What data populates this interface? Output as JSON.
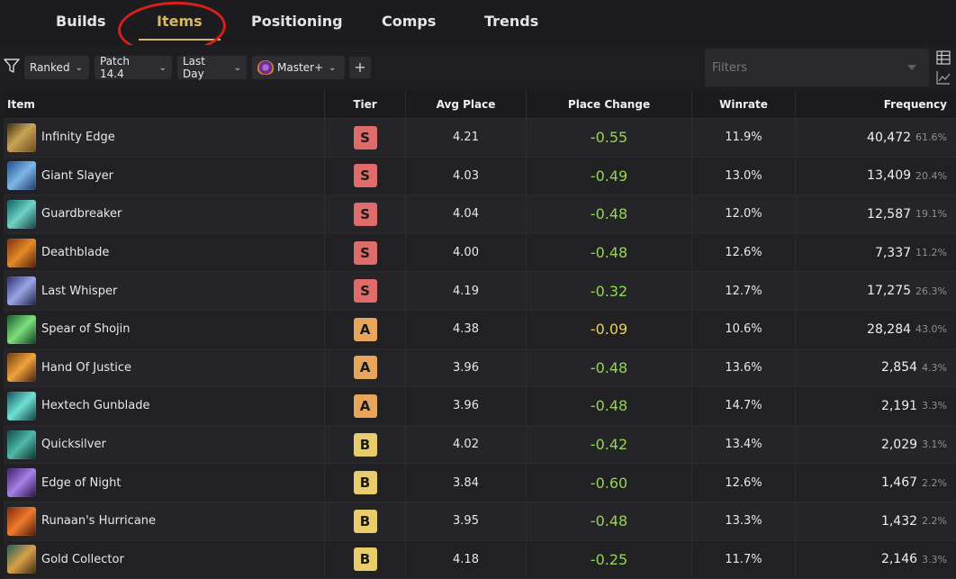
{
  "nav": {
    "tabs": [
      {
        "label": "Builds"
      },
      {
        "label": "Items"
      },
      {
        "label": "Positioning"
      },
      {
        "label": "Comps"
      },
      {
        "label": "Trends"
      }
    ],
    "active_tab": "Items",
    "highlight_color": "#d81e1e"
  },
  "filters": {
    "queue": "Ranked",
    "patch": "Patch 14.4",
    "period": "Last Day",
    "rank": "Master+",
    "add_label": "+",
    "search_placeholder": "Filters"
  },
  "table": {
    "headers": {
      "item": "Item",
      "tier": "Tier",
      "avg_place": "Avg Place",
      "place_change": "Place Change",
      "winrate": "Winrate",
      "frequency": "Frequency"
    },
    "rows": [
      {
        "name": "Infinity Edge",
        "icon": "infinity-edge-icon",
        "tier": "S",
        "avg": "4.21",
        "change": "-0.55",
        "winrate": "11.9%",
        "freq": "40,472",
        "pct": "61.6%"
      },
      {
        "name": "Giant Slayer",
        "icon": "giant-slayer-icon",
        "tier": "S",
        "avg": "4.03",
        "change": "-0.49",
        "winrate": "13.0%",
        "freq": "13,409",
        "pct": "20.4%"
      },
      {
        "name": "Guardbreaker",
        "icon": "guardbreaker-icon",
        "tier": "S",
        "avg": "4.04",
        "change": "-0.48",
        "winrate": "12.0%",
        "freq": "12,587",
        "pct": "19.1%"
      },
      {
        "name": "Deathblade",
        "icon": "deathblade-icon",
        "tier": "S",
        "avg": "4.00",
        "change": "-0.48",
        "winrate": "12.6%",
        "freq": "7,337",
        "pct": "11.2%"
      },
      {
        "name": "Last Whisper",
        "icon": "last-whisper-icon",
        "tier": "S",
        "avg": "4.19",
        "change": "-0.32",
        "winrate": "12.7%",
        "freq": "17,275",
        "pct": "26.3%"
      },
      {
        "name": "Spear of Shojin",
        "icon": "spear-of-shojin-icon",
        "tier": "A",
        "avg": "4.38",
        "change": "-0.09",
        "winrate": "10.6%",
        "freq": "28,284",
        "pct": "43.0%"
      },
      {
        "name": "Hand Of Justice",
        "icon": "hand-of-justice-icon",
        "tier": "A",
        "avg": "3.96",
        "change": "-0.48",
        "winrate": "13.6%",
        "freq": "2,854",
        "pct": "4.3%"
      },
      {
        "name": "Hextech Gunblade",
        "icon": "hextech-gunblade-icon",
        "tier": "A",
        "avg": "3.96",
        "change": "-0.48",
        "winrate": "14.7%",
        "freq": "2,191",
        "pct": "3.3%"
      },
      {
        "name": "Quicksilver",
        "icon": "quicksilver-icon",
        "tier": "B",
        "avg": "4.02",
        "change": "-0.42",
        "winrate": "13.4%",
        "freq": "2,029",
        "pct": "3.1%"
      },
      {
        "name": "Edge of Night",
        "icon": "edge-of-night-icon",
        "tier": "B",
        "avg": "3.84",
        "change": "-0.60",
        "winrate": "12.6%",
        "freq": "1,467",
        "pct": "2.2%"
      },
      {
        "name": "Runaan's Hurricane",
        "icon": "runaans-hurricane-icon",
        "tier": "B",
        "avg": "3.95",
        "change": "-0.48",
        "winrate": "13.3%",
        "freq": "1,432",
        "pct": "2.2%"
      },
      {
        "name": "Gold Collector",
        "icon": "gold-collector-icon",
        "tier": "B",
        "avg": "4.18",
        "change": "-0.25",
        "winrate": "11.7%",
        "freq": "2,146",
        "pct": "3.3%"
      }
    ]
  },
  "colors": {
    "tier_S": "#e06b6b",
    "tier_A": "#e8a55c",
    "tier_B": "#e9cd6c",
    "change_green": "#94d64f",
    "change_yellow": "#e8cf55",
    "accent": "#d8b765"
  }
}
